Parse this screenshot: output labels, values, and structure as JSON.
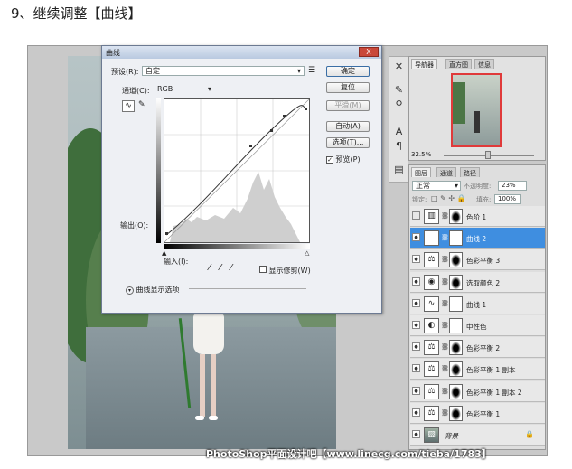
{
  "heading": "9、继续调整【曲线】",
  "dialog": {
    "title": "曲线",
    "close": "X",
    "preset_label": "预设(R):",
    "preset_value": "自定",
    "channel_label": "通道(C):",
    "channel_value": "RGB",
    "ok": "确定",
    "reset": "复位",
    "smooth": "平滑(M)",
    "auto": "自动(A)",
    "options": "选项(T)...",
    "preview": "预览(P)",
    "output_label": "输出(O):",
    "input_label": "输入(I):",
    "clipping": "显示修剪(W)",
    "display_options": "曲线显示选项"
  },
  "navigator": {
    "tabs": [
      "导航器",
      "直方图",
      "信息"
    ],
    "zoom": "32.5%"
  },
  "layers_panel": {
    "tabs": [
      "图层",
      "通道",
      "路径"
    ],
    "blend_mode": "正常",
    "opacity_label": "不透明度:",
    "opacity_value": "23%",
    "lock_label": "锁定:",
    "fill_label": "填充:",
    "fill_value": "100%",
    "layers": [
      {
        "name": "色阶 1",
        "icon": "levels-icon",
        "visible": false,
        "selected": false
      },
      {
        "name": "曲线 2",
        "icon": "curves-icon",
        "visible": true,
        "selected": true
      },
      {
        "name": "色彩平衡 3",
        "icon": "color-balance-icon",
        "visible": true,
        "selected": false
      },
      {
        "name": "选取颜色 2",
        "icon": "selective-color-icon",
        "visible": true,
        "selected": false
      },
      {
        "name": "曲线 1",
        "icon": "curves-icon",
        "visible": true,
        "selected": false
      },
      {
        "name": "中性色",
        "icon": "neutral-icon",
        "visible": true,
        "selected": false
      },
      {
        "name": "色彩平衡 2",
        "icon": "color-balance-icon",
        "visible": true,
        "selected": false
      },
      {
        "name": "色彩平衡 1 副本",
        "icon": "color-balance-icon",
        "visible": true,
        "selected": false
      },
      {
        "name": "色彩平衡 1 副本 2",
        "icon": "color-balance-icon",
        "visible": true,
        "selected": false
      },
      {
        "name": "色彩平衡 1",
        "icon": "color-balance-icon",
        "visible": true,
        "selected": false
      },
      {
        "name": "背景",
        "icon": "image-icon",
        "visible": true,
        "selected": false
      }
    ]
  },
  "watermark": "PhotoShop平面设计吧【www.linecg.com/tieba/1783】"
}
